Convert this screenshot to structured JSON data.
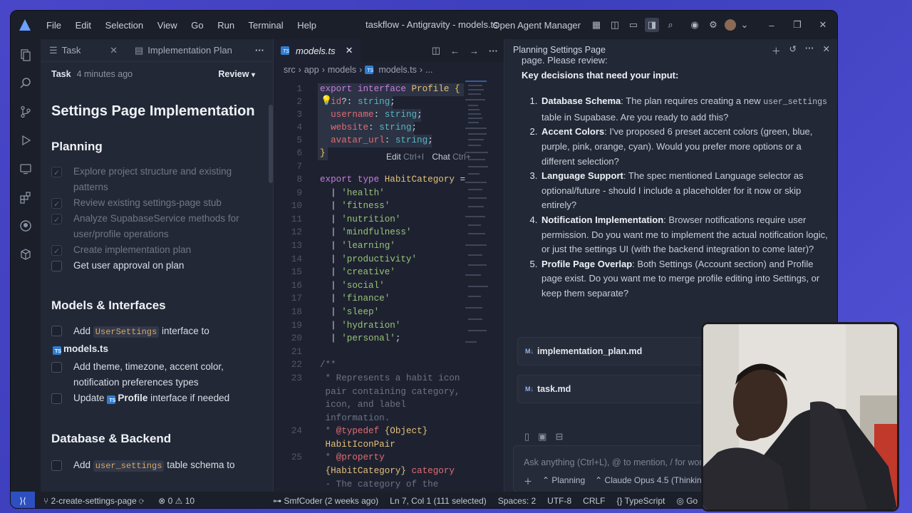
{
  "titlebar": {
    "menu": [
      "File",
      "Edit",
      "Selection",
      "View",
      "Go",
      "Run",
      "Terminal",
      "Help"
    ],
    "title": "taskflow - Antigravity - models.ts",
    "agent_manager": "Open Agent Manager"
  },
  "left": {
    "tabs": [
      "Task",
      "Implementation Plan"
    ],
    "task_label": "Task",
    "task_ago": "4 minutes ago",
    "review": "Review",
    "title": "Settings Page Implementation",
    "sec_planning": "Planning",
    "p1": "Explore project structure and existing patterns",
    "p2": "Review existing settings-page stub",
    "p3": "Analyze SupabaseService methods for user/profile operations",
    "p4": "Create implementation plan",
    "p5": "Get user approval on plan",
    "sec_models": "Models & Interfaces",
    "m1a": "Add",
    "m1code": "UserSettings",
    "m1b": "interface to",
    "m1file": "models.ts",
    "m2": "Add theme, timezone, accent color, notification preferences types",
    "m3a": "Update",
    "m3file": "Profile",
    "m3b": "interface if needed",
    "sec_db": "Database & Backend",
    "d1a": "Add",
    "d1code": "user_settings",
    "d1b": "table schema to"
  },
  "editor": {
    "tab": "models.ts",
    "breadcrumb": [
      "src",
      "app",
      "models",
      "models.ts",
      "..."
    ],
    "hint_edit": "Edit",
    "hint_edit_key": "Ctrl+I",
    "hint_chat": "Chat",
    "hint_chat_key": "Ctrl+"
  },
  "chat": {
    "header": "Planning Settings Page",
    "intro": "page. Please review:",
    "decisions": "Key decisions that need your input:",
    "q1t": "Database Schema",
    "q1a": ": The plan requires creating a new ",
    "q1code": "user_settings",
    "q1b": " table in Supabase. Are you ready to add this?",
    "q2t": "Accent Colors",
    "q2": ": I've proposed 6 preset accent colors (green, blue, purple, pink, orange, cyan). Would you prefer more options or a different selection?",
    "q3t": "Language Support",
    "q3": ": The spec mentioned Language selector as optional/future - should I include a placeholder for it now or skip entirely?",
    "q4t": "Notification Implementation",
    "q4": ": Browser notifications require user permission. Do you want me to implement the actual notification logic, or just the settings UI (with the backend integration to come later)?",
    "q5t": "Profile Page Overlap",
    "q5": ": Both Settings (Account section) and Profile page exist. Do you want me to merge profile editing into Settings, or keep them separate?",
    "file1": "implementation_plan.md",
    "file2": "task.md",
    "md_tag": "M↓",
    "placeholder": "Ask anything (Ctrl+L), @ to mention, / for workflo",
    "mode": "Planning",
    "model": "Claude Opus 4.5 (Thinking)"
  },
  "status": {
    "branch": "2-create-settings-page",
    "errors": "0",
    "warnings": "10",
    "author": "SmfCoder (2 weeks ago)",
    "pos": "Ln 7, Col 1 (111 selected)",
    "spaces": "Spaces: 2",
    "enc": "UTF-8",
    "eol": "CRLF",
    "lang": "TypeScript",
    "go": "Go"
  }
}
